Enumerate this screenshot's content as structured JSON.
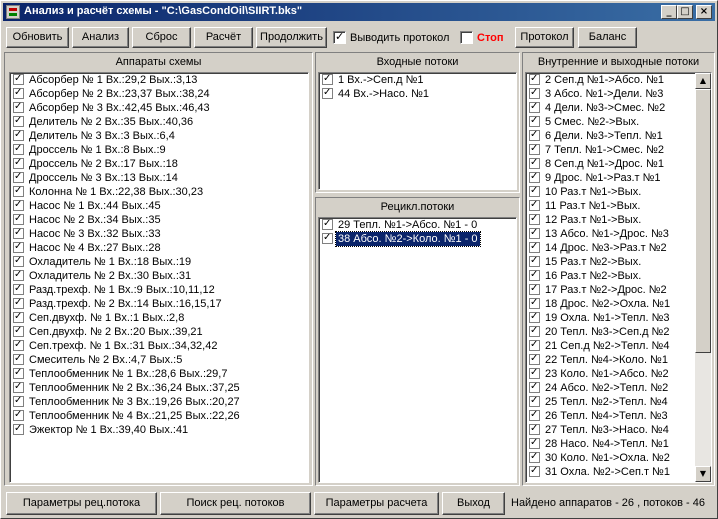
{
  "window": {
    "title": "Анализ и расчёт схемы - \"C:\\GasCondOil\\SIIRT.bks\"",
    "controls": [
      "_",
      "□",
      "×"
    ]
  },
  "toolbar": {
    "refresh": "Обновить",
    "analysis": "Анализ",
    "reset": "Сброс",
    "calculate": "Расчёт",
    "continue": "Продолжить",
    "show_protocol_label": "Выводить протокол",
    "show_protocol_checked": true,
    "stop_label": "Стоп",
    "stop_checked": false,
    "stop_color": "#ff0000",
    "protocol": "Протокол",
    "balance": "Баланс"
  },
  "apparatus": {
    "header": "Аппараты схемы",
    "selected_index": 28,
    "items": [
      "Абсорбер № 1 Вх.:29,2  Вых.:3,13",
      "Абсорбер № 2 Вх.:23,37  Вых.:38,24",
      "Абсорбер № 3 Вх.:42,45  Вых.:46,43",
      "Делитель № 2 Вх.:35  Вых.:40,36",
      "Делитель № 3 Вх.:3  Вых.:6,4",
      "Дроссель № 1 Вх.:8  Вых.:9",
      "Дроссель № 2 Вх.:17  Вых.:18",
      "Дроссель № 3 Вх.:13  Вых.:14",
      "Колонна № 1 Вх.:22,38  Вых.:30,23",
      "Насос № 1 Вх.:44  Вых.:45",
      "Насос № 2 Вх.:34  Вых.:35",
      "Насос № 3 Вх.:32  Вых.:33",
      "Насос № 4 Вх.:27  Вых.:28",
      "Охладитель № 1 Вх.:18  Вых.:19",
      "Охладитель № 2 Вх.:30  Вых.:31",
      "Разд.трехф. № 1 Вх.:9  Вых.:10,11,12",
      "Разд.трехф. № 2 Вх.:14  Вых.:16,15,17",
      "Сеп.двухф. № 1 Вх.:1  Вых.:2,8",
      "Сеп.двухф. № 2 Вх.:20  Вых.:39,21",
      "Сеп.трехф. № 1 Вх.:31  Вых.:34,32,42",
      "Смеситель № 2 Вх.:4,7  Вых.:5",
      "Теплообменник № 1 Вх.:28,6  Вых.:29,7",
      "Теплообменник № 2 Вх.:36,24  Вых.:37,25",
      "Теплообменник № 3 Вх.:19,26  Вых.:20,27",
      "Теплообменник № 4 Вх.:21,25  Вых.:22,26",
      "Эжектор № 1 Вх.:39,40  Вых.:41"
    ]
  },
  "input_streams": {
    "header": "Входные потоки",
    "items": [
      "1   Вх.->Сеп.д №1",
      "44   Вх.->Насо. №1"
    ]
  },
  "recycle_streams": {
    "header": "Рецикл.потоки",
    "selected_index": 1,
    "items": [
      "29 Тепл. №1->Абсо. №1 - 0",
      "38 Абсо. №2->Коло. №1 - 0"
    ]
  },
  "internal_streams": {
    "header": "Внутренние и выходные потоки",
    "items": [
      "2  Сеп.д №1->Абсо. №1",
      "3  Абсо. №1->Дели. №3",
      "4  Дели. №3->Смес. №2",
      "5  Смес. №2->Вых.",
      "6  Дели. №3->Тепл. №1",
      "7  Тепл. №1->Смес. №2",
      "8  Сеп.д №1->Дрос. №1",
      "9  Дрос. №1->Раз.т №1",
      "10  Раз.т №1->Вых.",
      "11  Раз.т №1->Вых.",
      "12  Раз.т №1->Вых.",
      "13  Абсо. №1->Дрос. №3",
      "14  Дрос. №3->Раз.т №2",
      "15  Раз.т №2->Вых.",
      "16  Раз.т №2->Вых.",
      "17  Раз.т №2->Дрос. №2",
      "18  Дрос. №2->Охла. №1",
      "19  Охла. №1->Тепл. №3",
      "20  Тепл. №3->Сеп.д №2",
      "21  Сеп.д №2->Тепл. №4",
      "22  Тепл. №4->Коло. №1",
      "23  Коло. №1->Абсо. №2",
      "24  Абсо. №2->Тепл. №2",
      "25  Тепл. №2->Тепл. №4",
      "26  Тепл. №4->Тепл. №3",
      "27  Тепл. №3->Насо. №4",
      "28  Насо. №4->Тепл. №1",
      "30  Коло. №1->Охла. №2",
      "31  Охла. №2->Сеп.т №1"
    ]
  },
  "bottom": {
    "recycle_params": "Параметры рец.потока",
    "search_recycle": "Поиск рец. потоков",
    "calc_params": "Параметры расчета",
    "exit": "Выход",
    "status": "Найдено аппаратов - 26 , потоков - 46"
  }
}
